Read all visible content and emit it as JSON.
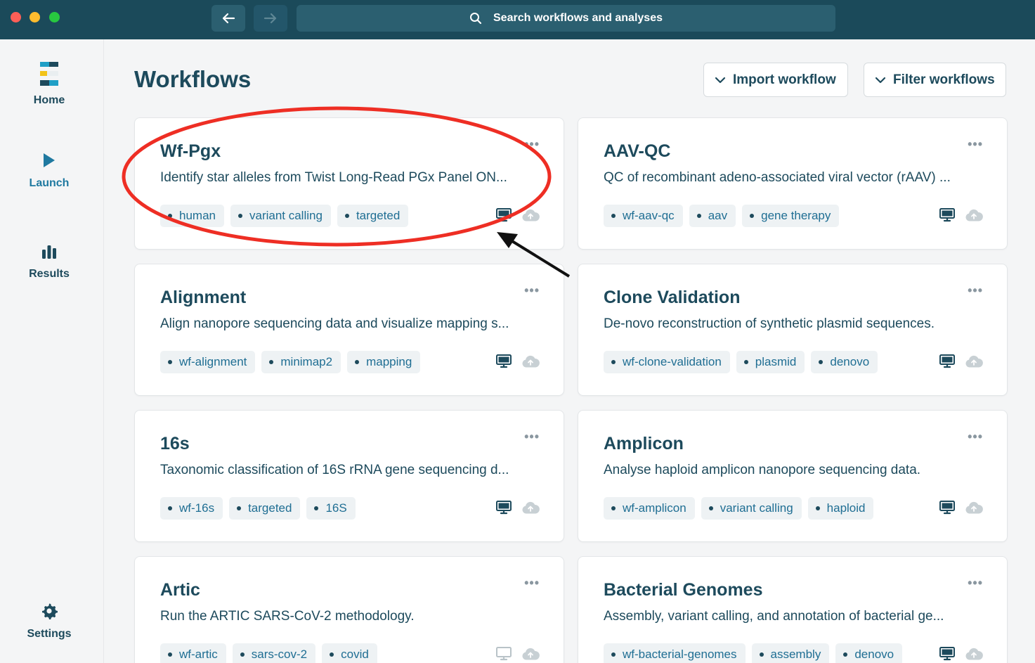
{
  "search": {
    "placeholder": "Search workflows and analyses"
  },
  "sidebar": {
    "items": [
      {
        "label": "Home"
      },
      {
        "label": "Launch"
      },
      {
        "label": "Results"
      },
      {
        "label": "Settings"
      }
    ]
  },
  "header": {
    "title": "Workflows",
    "import_label": "Import workflow",
    "filter_label": "Filter workflows"
  },
  "workflows": [
    {
      "title": "Wf-Pgx",
      "desc": "Identify star alleles from Twist Long-Read PGx Panel ON...",
      "tags": [
        "human",
        "variant calling",
        "targeted"
      ]
    },
    {
      "title": "AAV-QC",
      "desc": "QC of recombinant adeno-associated viral vector (rAAV) ...",
      "tags": [
        "wf-aav-qc",
        "aav",
        "gene therapy"
      ]
    },
    {
      "title": "Alignment",
      "desc": "Align nanopore sequencing data and visualize mapping s...",
      "tags": [
        "wf-alignment",
        "minimap2",
        "mapping"
      ]
    },
    {
      "title": "Clone Validation",
      "desc": "De-novo reconstruction of synthetic plasmid sequences.",
      "tags": [
        "wf-clone-validation",
        "plasmid",
        "denovo"
      ]
    },
    {
      "title": "16s",
      "desc": "Taxonomic classification of 16S rRNA gene sequencing d...",
      "tags": [
        "wf-16s",
        "targeted",
        "16S"
      ]
    },
    {
      "title": "Amplicon",
      "desc": "Analyse haploid amplicon nanopore sequencing data.",
      "tags": [
        "wf-amplicon",
        "variant calling",
        "haploid"
      ]
    },
    {
      "title": "Artic",
      "desc": "Run the ARTIC SARS-CoV-2 methodology.",
      "tags": [
        "wf-artic",
        "sars-cov-2",
        "covid"
      ]
    },
    {
      "title": "Bacterial Genomes",
      "desc": "Assembly, variant calling, and annotation of bacterial ge...",
      "tags": [
        "wf-bacterial-genomes",
        "assembly",
        "denovo"
      ]
    }
  ],
  "colors": {
    "titlebar": "#1b4a5a",
    "accent": "#1f79a0",
    "annotation": "#ee2e24"
  }
}
